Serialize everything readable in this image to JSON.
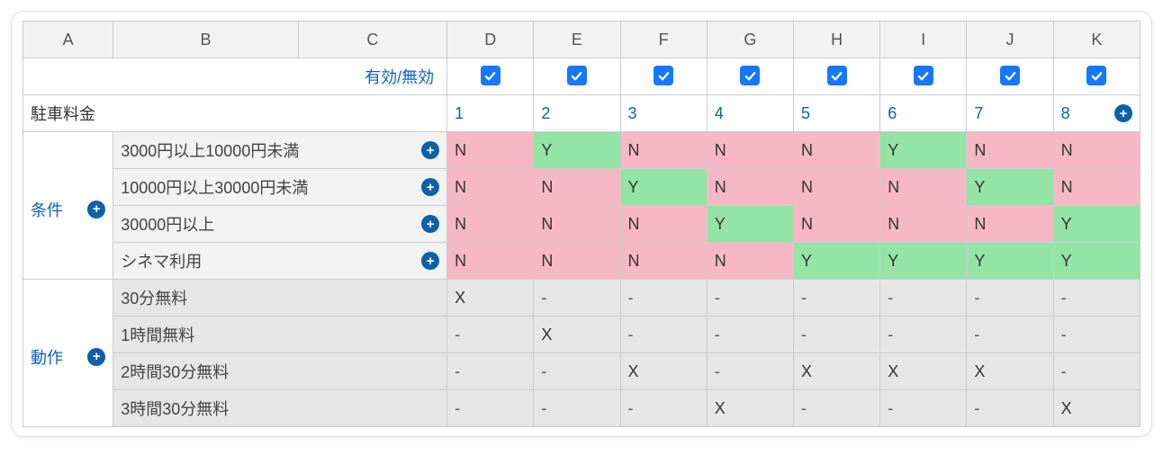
{
  "columns": [
    "A",
    "B",
    "C",
    "D",
    "E",
    "F",
    "G",
    "H",
    "I",
    "J",
    "K"
  ],
  "enabled_label": "有効/無効",
  "enabled": [
    true,
    true,
    true,
    true,
    true,
    true,
    true,
    true
  ],
  "title": "駐車料金",
  "rule_numbers": [
    "1",
    "2",
    "3",
    "4",
    "5",
    "6",
    "7",
    "8"
  ],
  "section_conditions": "条件",
  "section_actions": "動作",
  "conditions": [
    {
      "label": "3000円以上10000円未満",
      "values": [
        "N",
        "Y",
        "N",
        "N",
        "N",
        "Y",
        "N",
        "N"
      ]
    },
    {
      "label": "10000円以上30000円未満",
      "values": [
        "N",
        "N",
        "Y",
        "N",
        "N",
        "N",
        "Y",
        "N"
      ]
    },
    {
      "label": "30000円以上",
      "values": [
        "N",
        "N",
        "N",
        "Y",
        "N",
        "N",
        "N",
        "Y"
      ]
    },
    {
      "label": "シネマ利用",
      "values": [
        "N",
        "N",
        "N",
        "N",
        "Y",
        "Y",
        "Y",
        "Y"
      ]
    }
  ],
  "actions": [
    {
      "label": "30分無料",
      "values": [
        "X",
        "-",
        "-",
        "-",
        "-",
        "-",
        "-",
        "-"
      ]
    },
    {
      "label": "1時間無料",
      "values": [
        "-",
        "X",
        "-",
        "-",
        "-",
        "-",
        "-",
        "-"
      ]
    },
    {
      "label": "2時間30分無料",
      "values": [
        "-",
        "-",
        "X",
        "-",
        "X",
        "X",
        "X",
        "-"
      ]
    },
    {
      "label": "3時間30分無料",
      "values": [
        "-",
        "-",
        "-",
        "X",
        "-",
        "-",
        "-",
        "X"
      ]
    }
  ]
}
